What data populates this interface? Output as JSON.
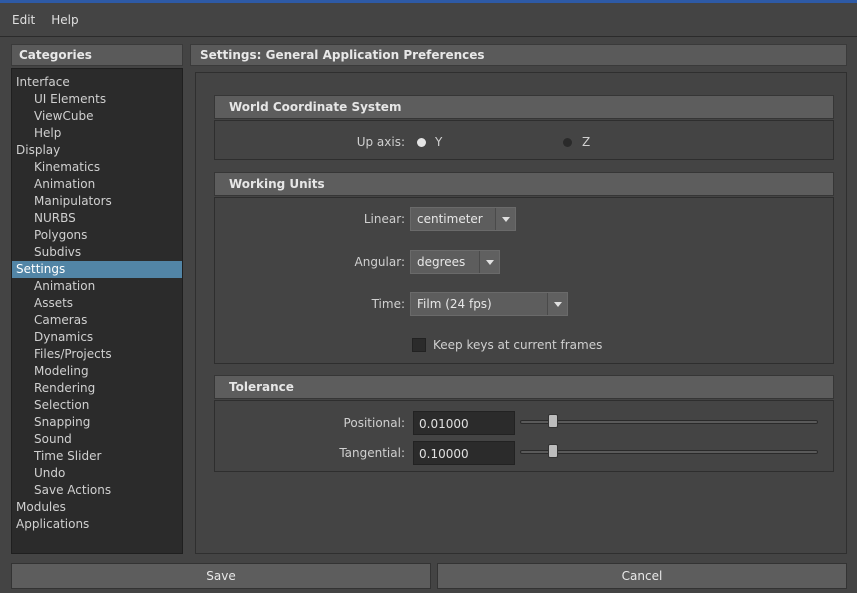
{
  "menu": {
    "edit": "Edit",
    "help": "Help"
  },
  "categories": {
    "header": "Categories",
    "items": [
      {
        "label": "Interface",
        "level": 0
      },
      {
        "label": "UI Elements",
        "level": 1
      },
      {
        "label": "ViewCube",
        "level": 1
      },
      {
        "label": "Help",
        "level": 1
      },
      {
        "label": "Display",
        "level": 0
      },
      {
        "label": "Kinematics",
        "level": 1
      },
      {
        "label": "Animation",
        "level": 1
      },
      {
        "label": "Manipulators",
        "level": 1
      },
      {
        "label": "NURBS",
        "level": 1
      },
      {
        "label": "Polygons",
        "level": 1
      },
      {
        "label": "Subdivs",
        "level": 1
      },
      {
        "label": "Settings",
        "level": 0,
        "selected": true
      },
      {
        "label": "Animation",
        "level": 1
      },
      {
        "label": "Assets",
        "level": 1
      },
      {
        "label": "Cameras",
        "level": 1
      },
      {
        "label": "Dynamics",
        "level": 1
      },
      {
        "label": "Files/Projects",
        "level": 1
      },
      {
        "label": "Modeling",
        "level": 1
      },
      {
        "label": "Rendering",
        "level": 1
      },
      {
        "label": "Selection",
        "level": 1
      },
      {
        "label": "Snapping",
        "level": 1
      },
      {
        "label": "Sound",
        "level": 1
      },
      {
        "label": "Time Slider",
        "level": 1
      },
      {
        "label": "Undo",
        "level": 1
      },
      {
        "label": "Save Actions",
        "level": 1
      },
      {
        "label": "Modules",
        "level": 0
      },
      {
        "label": "Applications",
        "level": 0
      }
    ]
  },
  "settings": {
    "header": "Settings: General Application Preferences",
    "world": {
      "title": "World Coordinate System",
      "up_axis_label": "Up axis:",
      "option_y": "Y",
      "option_z": "Z",
      "selected": "Y"
    },
    "units": {
      "title": "Working Units",
      "linear_label": "Linear:",
      "linear_value": "centimeter",
      "angular_label": "Angular:",
      "angular_value": "degrees",
      "time_label": "Time:",
      "time_value": "Film (24 fps)",
      "keep_keys_label": "Keep keys at current frames",
      "keep_keys_checked": false
    },
    "tolerance": {
      "title": "Tolerance",
      "positional_label": "Positional:",
      "positional_value": "0.01000",
      "tangential_label": "Tangential:",
      "tangential_value": "0.10000"
    }
  },
  "buttons": {
    "save": "Save",
    "cancel": "Cancel"
  },
  "colors": {
    "accent": "#2e5aa6",
    "selection": "#5285a6"
  }
}
